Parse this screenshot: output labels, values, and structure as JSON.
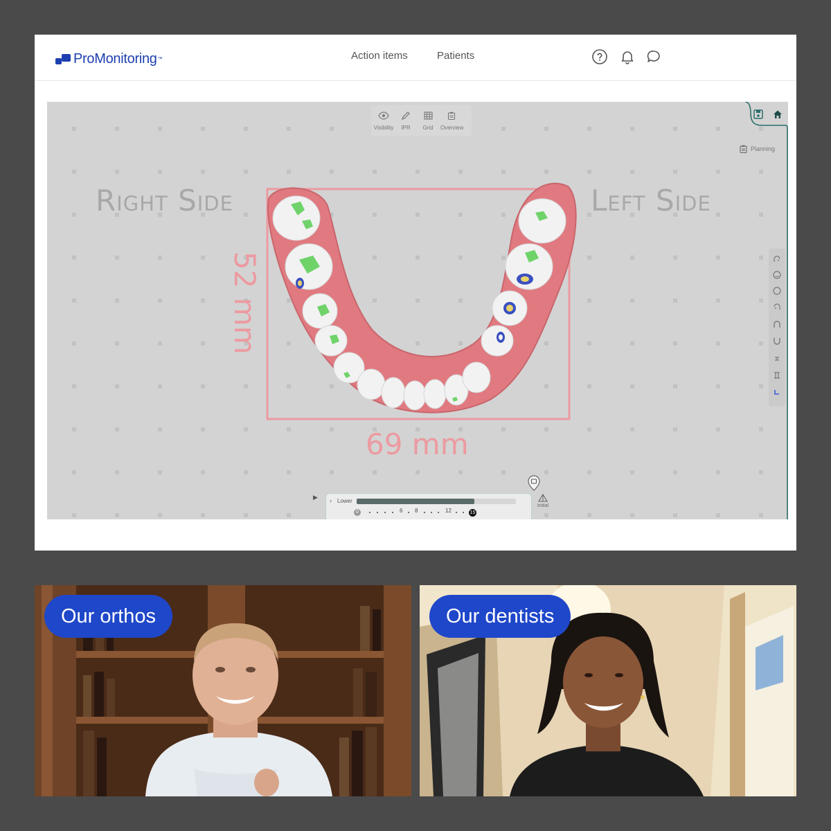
{
  "header": {
    "brand": "ProMonitoring",
    "brand_tm": "™",
    "nav": [
      {
        "label": "Action items"
      },
      {
        "label": "Patients"
      }
    ],
    "icons": [
      "help-icon",
      "bell-icon",
      "chat-icon"
    ]
  },
  "viewer": {
    "toolbar": [
      {
        "label": "Visibility",
        "icon": "eye-icon"
      },
      {
        "label": "IPR",
        "icon": "pencil-icon"
      },
      {
        "label": "Grid",
        "icon": "grid-icon"
      },
      {
        "label": "Overview",
        "icon": "clipboard-icon"
      }
    ],
    "right_side_label": "Right Side",
    "left_side_label": "Left Side",
    "width_measure": "69 mm",
    "height_measure": "52 mm",
    "planning_label": "Planning",
    "arch_colors": {
      "gum": "#e07a80",
      "tooth": "#f2f2f2",
      "contact_green": "#6fd36a",
      "contact_blue": "#3a4fc0",
      "measure": "#ec9aa0"
    },
    "timeline": {
      "arch": "Lower",
      "start_step": "0",
      "current_step": "15",
      "progress": 0.74,
      "tick_labels": [
        "6",
        "8",
        "12"
      ],
      "initial_label": "Initial"
    }
  },
  "videos": [
    {
      "label": "Our orthos"
    },
    {
      "label": "Our dentists"
    }
  ],
  "colors": {
    "background": "#4a4a4a",
    "brand": "#1d3fb0",
    "pill": "#1f47c9",
    "panel_accent": "#2a6e6a"
  }
}
